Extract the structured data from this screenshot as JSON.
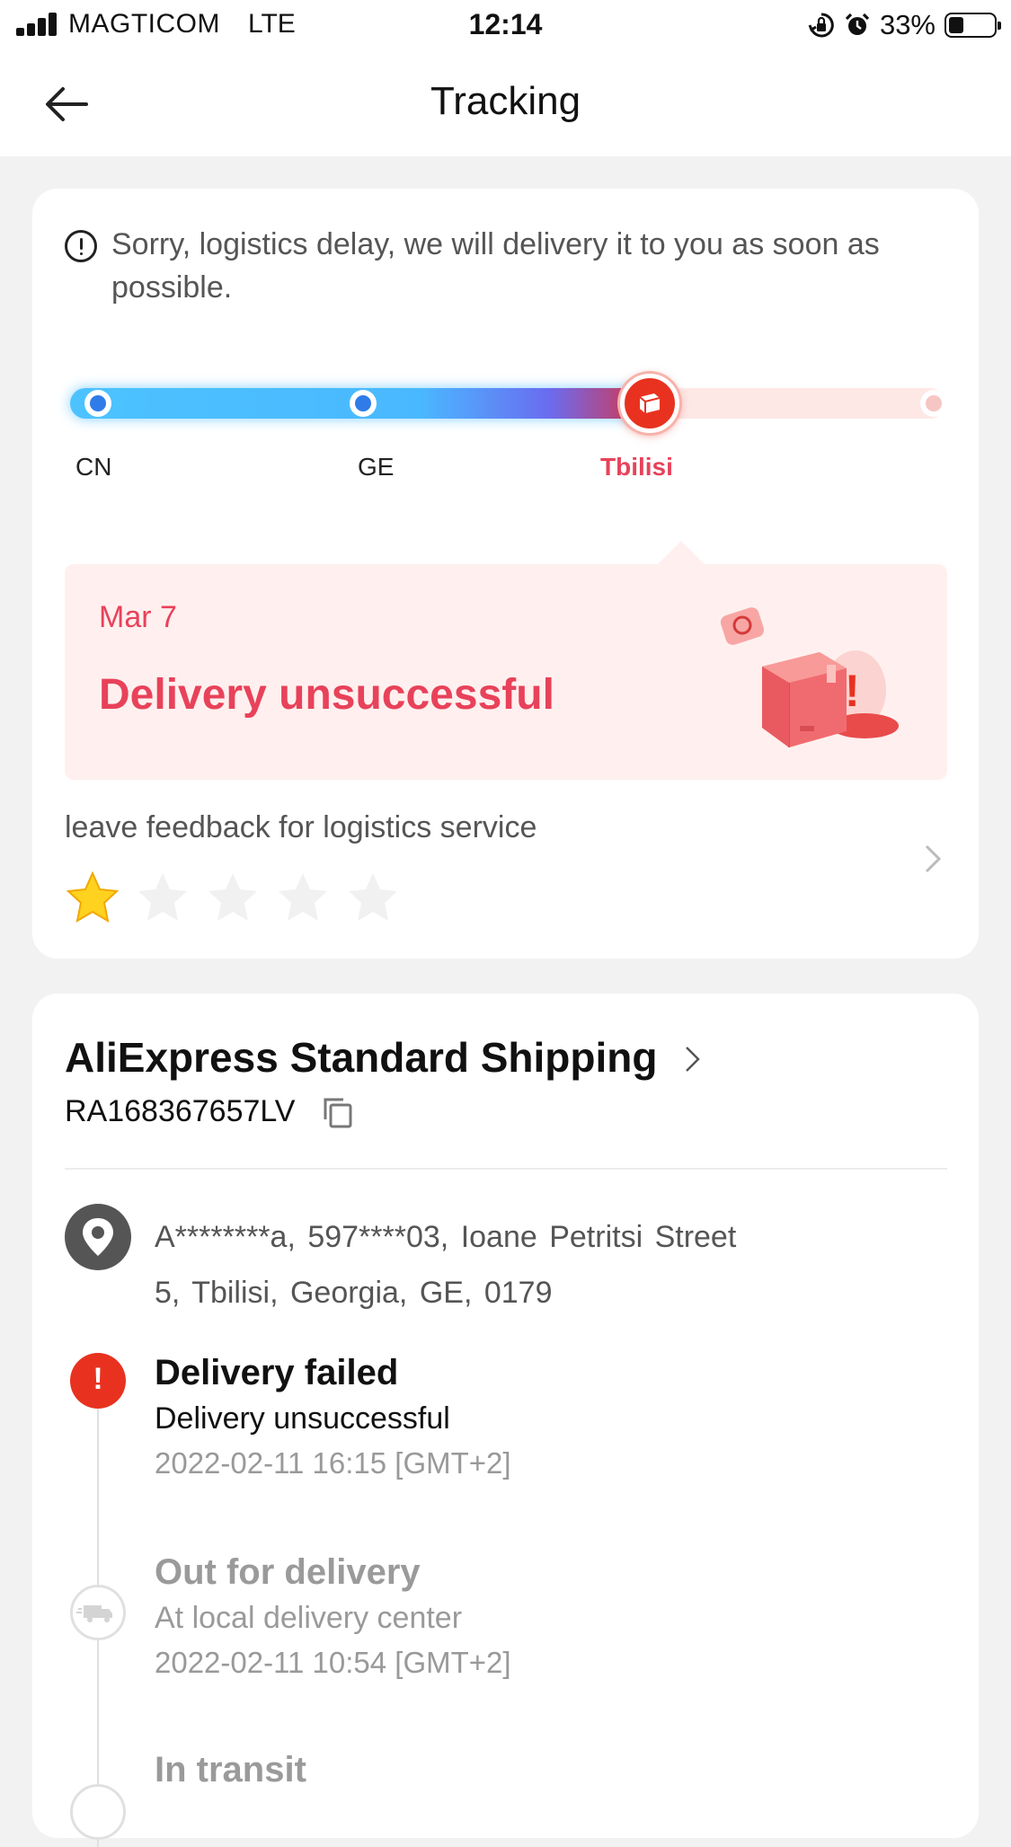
{
  "status_bar": {
    "carrier": "MAGTICOM",
    "network": "LTE",
    "time": "12:14",
    "battery_percent": "33%",
    "battery_level": 0.33
  },
  "header": {
    "title": "Tracking",
    "back_icon": "arrow-left-icon"
  },
  "notice": {
    "text": "Sorry, logistics delay, we will delivery it to you as soon as possible.",
    "icon": "exclamation-circle-icon"
  },
  "progress": {
    "stops": [
      {
        "label": "CN",
        "state": "done"
      },
      {
        "label": "GE",
        "state": "done"
      },
      {
        "label": "Tbilisi",
        "state": "current"
      },
      {
        "label": "",
        "state": "pending"
      }
    ],
    "colors": {
      "done": "#2f7be8",
      "current": "#e8321f",
      "pending": "#f6c6c4"
    }
  },
  "status_banner": {
    "date": "Mar 7",
    "status": "Delivery unsuccessful",
    "illustration": "package-alert-illustration",
    "accent_color": "#e8425a"
  },
  "feedback": {
    "prompt": "leave feedback for logistics service",
    "rating": 1,
    "max_rating": 5
  },
  "shipping": {
    "service": "AliExpress Standard Shipping",
    "tracking_number": "RA168367657LV",
    "address_line1": "A********a,  597****03,  Ioane Petritsi Street",
    "address_line2": "5,  Tbilisi,  Georgia,  GE,  0179"
  },
  "events": [
    {
      "title": "Delivery failed",
      "description": "Delivery unsuccessful",
      "time": "2022-02-11 16:15 [GMT+2]",
      "icon": "alert-icon",
      "state": "active"
    },
    {
      "title": "Out for delivery",
      "description": "At local delivery center",
      "time": "2022-02-11 10:54 [GMT+2]",
      "icon": "truck-icon",
      "state": "past"
    },
    {
      "title": "In transit",
      "description": "",
      "time": "",
      "icon": "transit-icon",
      "state": "past"
    }
  ]
}
